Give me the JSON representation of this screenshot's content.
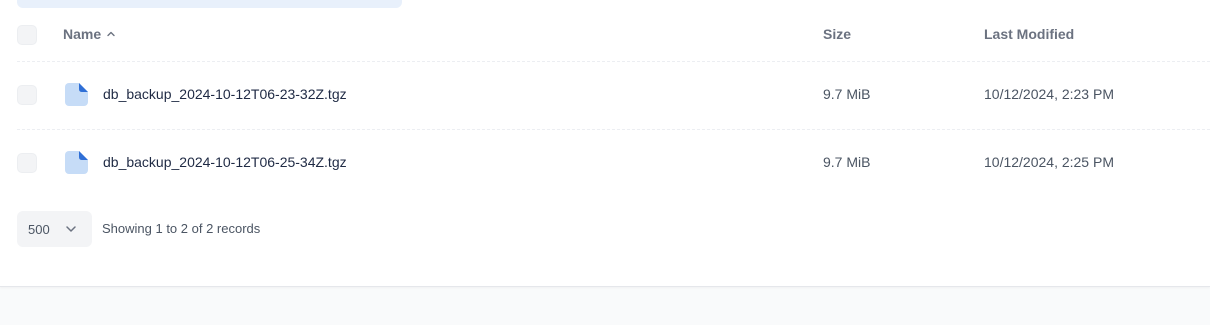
{
  "table": {
    "columns": {
      "name": "Name",
      "size": "Size",
      "modified": "Last Modified"
    },
    "sort": {
      "column": "name",
      "direction": "asc",
      "icon": "chevron-up-icon"
    },
    "rows": [
      {
        "name": "db_backup_2024-10-12T06-23-32Z.tgz",
        "size": "9.7 MiB",
        "modified": "10/12/2024, 2:23 PM",
        "icon": "file-icon"
      },
      {
        "name": "db_backup_2024-10-12T06-25-34Z.tgz",
        "size": "9.7 MiB",
        "modified": "10/12/2024, 2:25 PM",
        "icon": "file-icon"
      }
    ]
  },
  "pagination": {
    "per_page": "500",
    "records_text": "Showing 1 to 2 of 2 records"
  },
  "colors": {
    "file_icon": "#c6dcf7",
    "file_icon_corner": "#2f6fd6",
    "checkbox_bg": "#f3f4f6"
  }
}
